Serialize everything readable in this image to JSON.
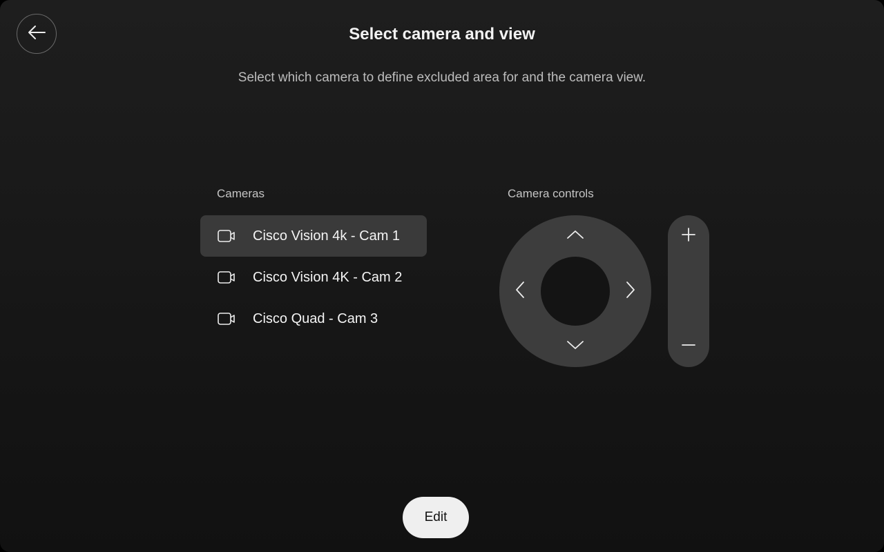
{
  "header": {
    "title": "Select camera and view",
    "subtitle": "Select which camera to define excluded area for and the camera view.",
    "back_icon": "arrow-left-icon"
  },
  "cameras": {
    "label": "Cameras",
    "selected_index": 0,
    "items": [
      {
        "name": "Cisco Vision 4k - Cam 1",
        "icon": "video-camera-icon"
      },
      {
        "name": "Cisco Vision 4K - Cam 2",
        "icon": "video-camera-icon"
      },
      {
        "name": "Cisco Quad - Cam 3",
        "icon": "video-camera-icon"
      }
    ]
  },
  "controls": {
    "label": "Camera controls",
    "pan_tilt_icons": [
      "chevron-up-icon",
      "chevron-down-icon",
      "chevron-left-icon",
      "chevron-right-icon"
    ],
    "zoom_icons": [
      "plus-icon",
      "minus-icon"
    ]
  },
  "footer": {
    "edit_label": "Edit"
  },
  "colors": {
    "background": "#161616",
    "selected_row": "#3a3a3a",
    "control_surface": "#3d3d3d",
    "primary_button": "#efefef"
  }
}
